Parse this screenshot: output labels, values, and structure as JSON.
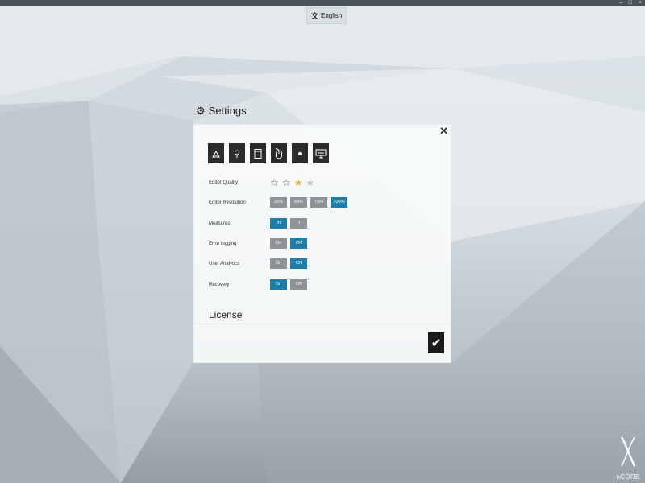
{
  "window": {
    "title": "",
    "controls": [
      "–",
      "□",
      "×"
    ]
  },
  "language": {
    "icon": "translate-icon",
    "label": "English"
  },
  "settings": {
    "icon": "gear-icon",
    "title": "Settings",
    "close_icon": "close-icon",
    "toolbar": [
      {
        "icon": "triangle-tool-icon"
      },
      {
        "icon": "pin-tool-icon"
      },
      {
        "icon": "frame-tool-icon"
      },
      {
        "icon": "mouse-tool-icon"
      },
      {
        "icon": "eye-tool-icon"
      },
      {
        "icon": "monitor-tool-icon"
      }
    ],
    "rows": [
      {
        "label": "Editor Quality",
        "type": "stars",
        "rating": 3,
        "max": 4
      },
      {
        "label": "Editor Resolution",
        "options": [
          "25%",
          "50%",
          "75%",
          "100%"
        ],
        "active": 3
      },
      {
        "label": "Measures",
        "options": [
          "m",
          "ft"
        ],
        "active": 0
      },
      {
        "label": "Error logging",
        "options": [
          "On",
          "Off"
        ],
        "active": 1
      },
      {
        "label": "User Analytics",
        "options": [
          "On",
          "Off"
        ],
        "active": 1
      },
      {
        "label": "Recovery",
        "options": [
          "On",
          "Off"
        ],
        "active": 0
      }
    ],
    "license": {
      "heading": "License",
      "text": ""
    },
    "confirm_icon": "checkmark-icon"
  },
  "brand": {
    "icon": "x-logo-icon",
    "text": "nCORE"
  },
  "colors": {
    "accent": "#1f7ea8",
    "inactive": "#8e9396",
    "star_filled": "#e8b52a",
    "star_empty": "#c4c8cb"
  }
}
